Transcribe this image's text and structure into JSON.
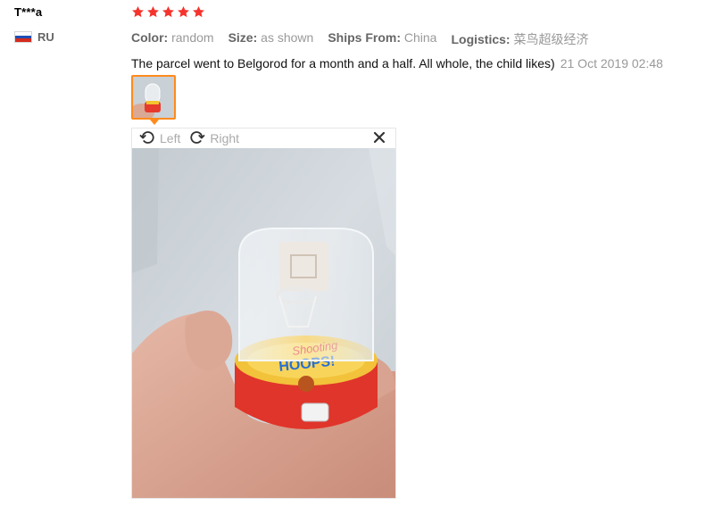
{
  "reviewer": {
    "name": "T***a",
    "country_code": "RU"
  },
  "review": {
    "rating": 5,
    "attributes": [
      {
        "key": "Color:",
        "value": "random"
      },
      {
        "key": "Size:",
        "value": "as shown"
      },
      {
        "key": "Ships From:",
        "value": "China"
      },
      {
        "key": "Logistics:",
        "value": "菜鸟超级经济"
      }
    ],
    "text": "The parcel went to Belgorod for a month and a half. All whole, the child likes)",
    "date": "21 Oct 2019 02:48"
  },
  "viewer": {
    "rotate_left_label": "Left",
    "rotate_right_label": "Right",
    "icons": {
      "rotate_left": "rotate-left-icon",
      "rotate_right": "rotate-right-icon",
      "close": "close-icon"
    }
  },
  "colors": {
    "star": "#f5332d",
    "thumb_border": "#ff8a1d",
    "flag_white": "#ffffff",
    "flag_blue": "#1f4fb4",
    "flag_red": "#d52b1e"
  }
}
